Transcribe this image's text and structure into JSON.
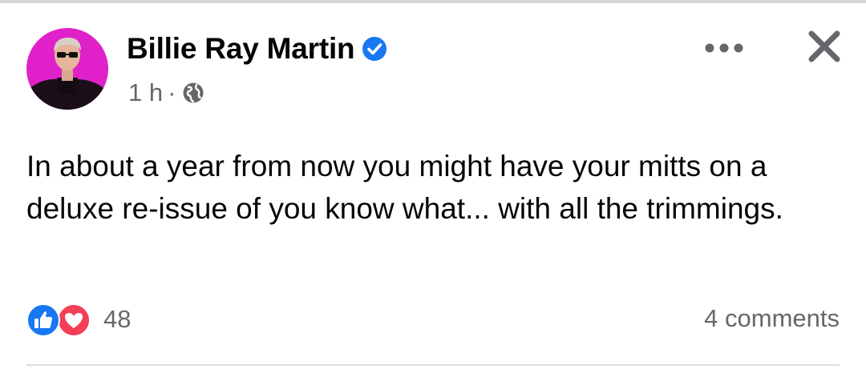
{
  "post": {
    "author": {
      "name": "Billie Ray Martin",
      "verified": true,
      "avatar_icon": "profile-photo"
    },
    "meta": {
      "time": "1 h",
      "separator": "·",
      "audience_icon": "globe-icon"
    },
    "actions": {
      "more_icon": "ellipsis-icon",
      "close_icon": "close-icon"
    },
    "text": "In about a year from now you might have your mitts on a deluxe re-issue of you know what... with all the trimmings.",
    "reactions": {
      "types": [
        "like",
        "love"
      ],
      "count": "48"
    },
    "comments_label": "4 comments"
  },
  "colors": {
    "verified_blue": "#1877f2",
    "like_blue": "#1877f2",
    "love_red": "#f33e58",
    "secondary_text": "#65676b",
    "primary_text": "#050505",
    "avatar_background": "#e020c8"
  }
}
